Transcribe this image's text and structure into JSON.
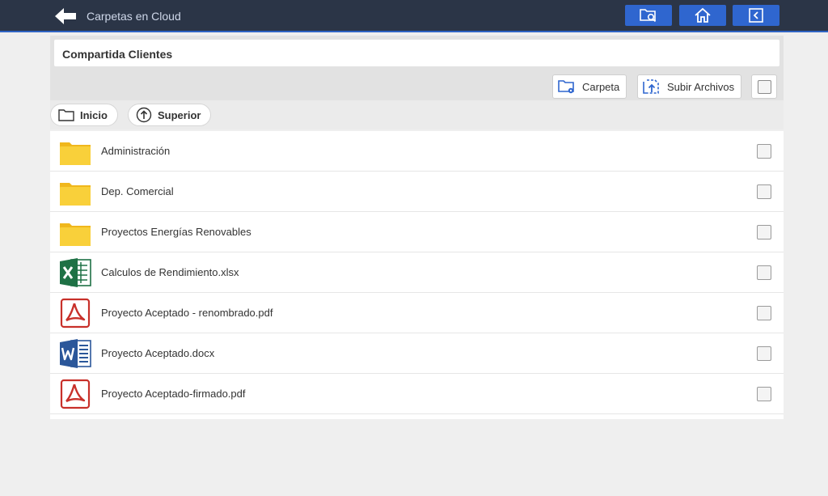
{
  "header": {
    "title": "Carpetas en Cloud",
    "back_icon": "arrow-left-icon",
    "buttons": [
      {
        "name": "folder-search-button",
        "icon": "folder-search-icon"
      },
      {
        "name": "home-button",
        "icon": "home-icon"
      },
      {
        "name": "collapse-button",
        "icon": "chevron-left-box-icon"
      }
    ]
  },
  "path": {
    "label": "Compartida Clientes"
  },
  "toolbar": {
    "folder_label": "Carpeta",
    "upload_label": "Subir Archivos"
  },
  "nav": {
    "home_label": "Inicio",
    "up_label": "Superior"
  },
  "files": [
    {
      "name": "Administración",
      "type": "folder"
    },
    {
      "name": "Dep. Comercial",
      "type": "folder"
    },
    {
      "name": "Proyectos Energías Renovables",
      "type": "folder"
    },
    {
      "name": "Calculos de Rendimiento.xlsx",
      "type": "excel"
    },
    {
      "name": "Proyecto Aceptado - renombrado.pdf",
      "type": "pdf"
    },
    {
      "name": "Proyecto Aceptado.docx",
      "type": "word"
    },
    {
      "name": "Proyecto Aceptado-firmado.pdf",
      "type": "pdf"
    }
  ],
  "colors": {
    "topbar": "#2b3547",
    "accent": "#2f66cf",
    "folder": "#f7c928",
    "excel": "#1e7145",
    "word": "#2b579a",
    "pdf": "#c8302a"
  }
}
